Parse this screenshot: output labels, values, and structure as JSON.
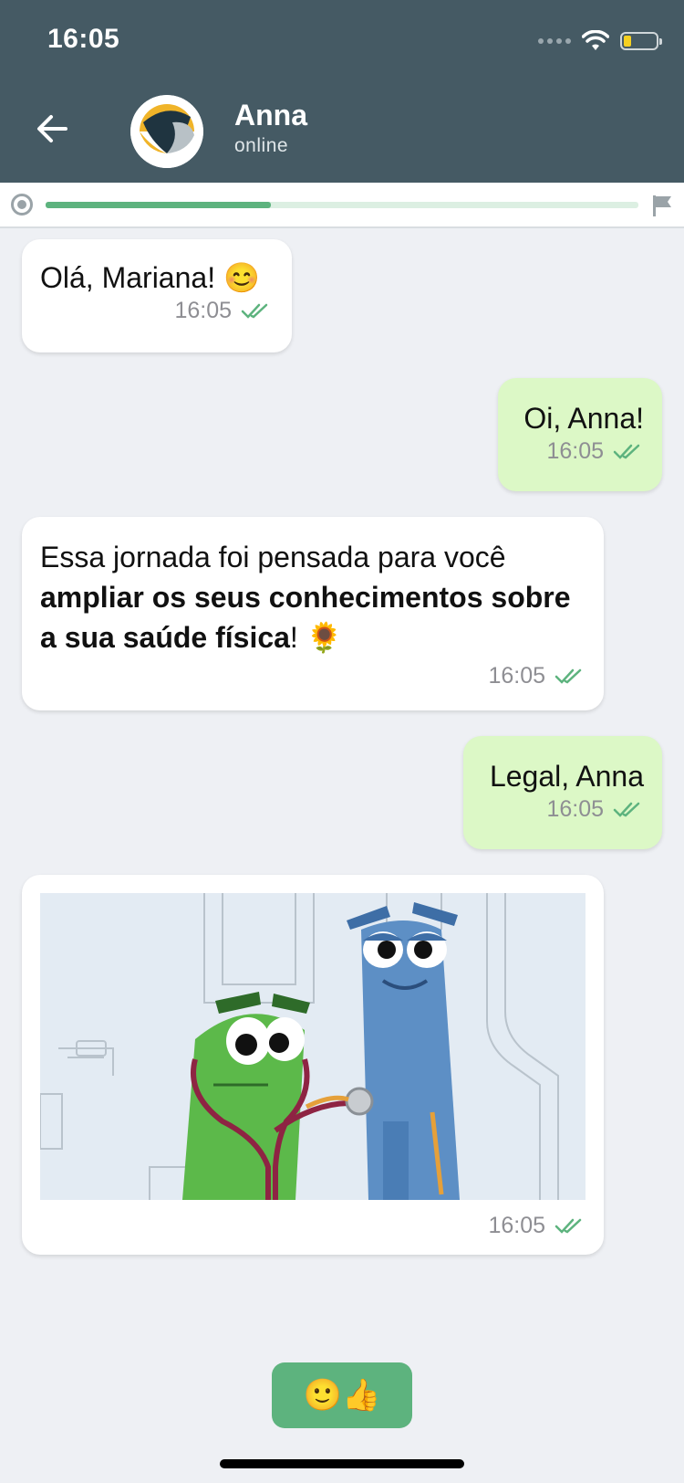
{
  "status_bar": {
    "time": "16:05"
  },
  "header": {
    "contact_name": "Anna",
    "contact_status": "online"
  },
  "progress": {
    "fraction": 0.38
  },
  "messages": [
    {
      "side": "incoming",
      "text": "Olá, Mariana! 😊",
      "time": "16:05"
    },
    {
      "side": "outgoing",
      "text": "Oi, Anna!",
      "time": "16:05"
    },
    {
      "side": "incoming",
      "text_plain": "Essa jornada foi pensada para você ",
      "text_bold": "ampliar os seus conhecimentos sobre a sua saúde física",
      "text_tail": "! 🌻",
      "time": "16:05"
    },
    {
      "side": "outgoing",
      "text": "Legal, Anna",
      "time": "16:05"
    },
    {
      "side": "incoming",
      "type": "image",
      "time": "16:05"
    }
  ],
  "reaction": {
    "label": "🙂👍"
  },
  "colors": {
    "header": "#455a64",
    "accent": "#5db37e",
    "outgoing_bubble": "#dcf8c6",
    "check": "#5db37e"
  },
  "icons": [
    "back-arrow-icon",
    "wifi-icon",
    "battery-icon",
    "progress-start-icon",
    "flag-icon",
    "double-check-icon"
  ]
}
